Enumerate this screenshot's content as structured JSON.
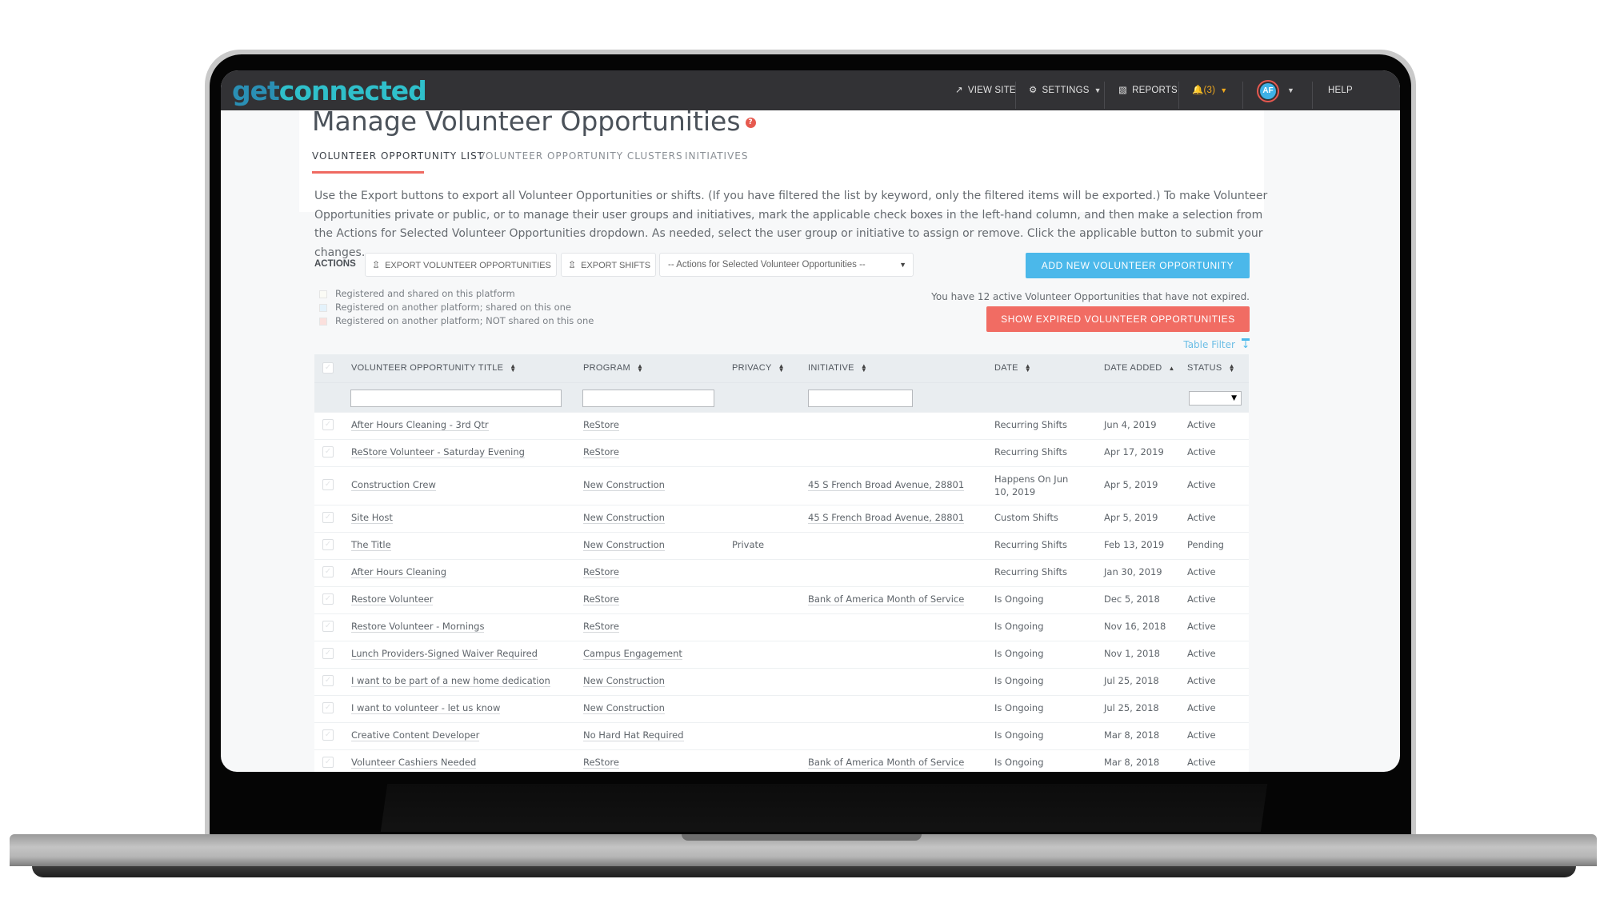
{
  "nav": {
    "logo_get": "get",
    "logo_connected": "connected",
    "view_site": "VIEW SITE",
    "settings": "SETTINGS",
    "reports": "REPORTS",
    "notifications": "(3)",
    "avatar_initials": "AF",
    "help": "HELP"
  },
  "page": {
    "title": "Manage Volunteer Opportunities",
    "help_icon": "?",
    "tabs": [
      {
        "label": "VOLUNTEER OPPORTUNITY LIST",
        "active": true
      },
      {
        "label": "VOLUNTEER OPPORTUNITY CLUSTERS",
        "active": false
      },
      {
        "label": "INITIATIVES",
        "active": false
      }
    ],
    "description": "Use the Export buttons to export all Volunteer Opportunities or shifts. (If you have filtered the list by keyword, only the filtered items will be exported.) To make Volunteer Opportunities private or public, or to manage their user groups and initiatives, mark the applicable check boxes in the left-hand column, and then make a selection from the Actions for Selected Volunteer Opportunities dropdown. As needed, select the user group or initiative to assign or remove. Click the applicable button to submit your changes."
  },
  "actions": {
    "label": "ACTIONS",
    "export_opportunities": "EXPORT VOLUNTEER OPPORTUNITIES",
    "export_shifts": "EXPORT SHIFTS",
    "bulk_select": "-- Actions for Selected Volunteer Opportunities --",
    "add_new": "ADD NEW VOLUNTEER OPPORTUNITY",
    "show_expired": "SHOW EXPIRED VOLUNTEER OPPORTUNITIES",
    "active_count_text": "You have 12 active Volunteer Opportunities that have not expired.",
    "table_filter": "Table Filter"
  },
  "legend": [
    {
      "label": "Registered and shared on this platform",
      "color": "#fbfbf5"
    },
    {
      "label": "Registered on another platform; shared on this one",
      "color": "#e4f2fb"
    },
    {
      "label": "Registered on another platform; NOT shared on this one",
      "color": "#fbe0dd"
    }
  ],
  "colors": {
    "accent_blue": "#4bb8ea",
    "accent_red": "#f16c63",
    "nav_bg": "#323235",
    "notification": "#f0a91e"
  },
  "table": {
    "columns": [
      "VOLUNTEER OPPORTUNITY TITLE",
      "PROGRAM",
      "PRIVACY",
      "INITIATIVE",
      "DATE",
      "DATE ADDED",
      "STATUS"
    ],
    "sorted_column": "DATE ADDED",
    "sort_direction": "ascending",
    "rows": [
      {
        "title": "After Hours Cleaning - 3rd Qtr",
        "program": "ReStore",
        "privacy": "",
        "initiative": "",
        "date": "Recurring Shifts",
        "date_added": "Jun 4, 2019",
        "status": "Active"
      },
      {
        "title": "ReStore Volunteer - Saturday Evening",
        "program": "ReStore",
        "privacy": "",
        "initiative": "",
        "date": "Recurring Shifts",
        "date_added": "Apr 17, 2019",
        "status": "Active"
      },
      {
        "title": "Construction Crew",
        "program": "New Construction",
        "privacy": "",
        "initiative": "45 S French Broad Avenue, 28801",
        "date": "Happens On Jun 10, 2019",
        "date_added": "Apr 5, 2019",
        "status": "Active"
      },
      {
        "title": "Site Host",
        "program": "New Construction",
        "privacy": "",
        "initiative": "45 S French Broad Avenue, 28801",
        "date": "Custom Shifts",
        "date_added": "Apr 5, 2019",
        "status": "Active"
      },
      {
        "title": "The Title",
        "program": "New Construction",
        "privacy": "Private",
        "initiative": "",
        "date": "Recurring Shifts",
        "date_added": "Feb 13, 2019",
        "status": "Pending"
      },
      {
        "title": "After Hours Cleaning",
        "program": "ReStore",
        "privacy": "",
        "initiative": "",
        "date": "Recurring Shifts",
        "date_added": "Jan 30, 2019",
        "status": "Active"
      },
      {
        "title": "Restore Volunteer",
        "program": "ReStore",
        "privacy": "",
        "initiative": "Bank of America Month of Service",
        "date": "Is Ongoing",
        "date_added": "Dec 5, 2018",
        "status": "Active"
      },
      {
        "title": "Restore Volunteer - Mornings",
        "program": "ReStore",
        "privacy": "",
        "initiative": "",
        "date": "Is Ongoing",
        "date_added": "Nov 16, 2018",
        "status": "Active"
      },
      {
        "title": "Lunch Providers-Signed Waiver Required",
        "program": "Campus Engagement",
        "privacy": "",
        "initiative": "",
        "date": "Is Ongoing",
        "date_added": "Nov 1, 2018",
        "status": "Active"
      },
      {
        "title": "I want to be part of a new home dedication",
        "program": "New Construction",
        "privacy": "",
        "initiative": "",
        "date": "Is Ongoing",
        "date_added": "Jul 25, 2018",
        "status": "Active"
      },
      {
        "title": "I want to volunteer - let us know",
        "program": "New Construction",
        "privacy": "",
        "initiative": "",
        "date": "Is Ongoing",
        "date_added": "Jul 25, 2018",
        "status": "Active"
      },
      {
        "title": "Creative Content Developer",
        "program": "No Hard Hat Required",
        "privacy": "",
        "initiative": "",
        "date": "Is Ongoing",
        "date_added": "Mar 8, 2018",
        "status": "Active"
      },
      {
        "title": "Volunteer Cashiers Needed",
        "program": "ReStore",
        "privacy": "",
        "initiative": "Bank of America Month of Service",
        "date": "Is Ongoing",
        "date_added": "Mar 8, 2018",
        "status": "Active"
      }
    ]
  }
}
